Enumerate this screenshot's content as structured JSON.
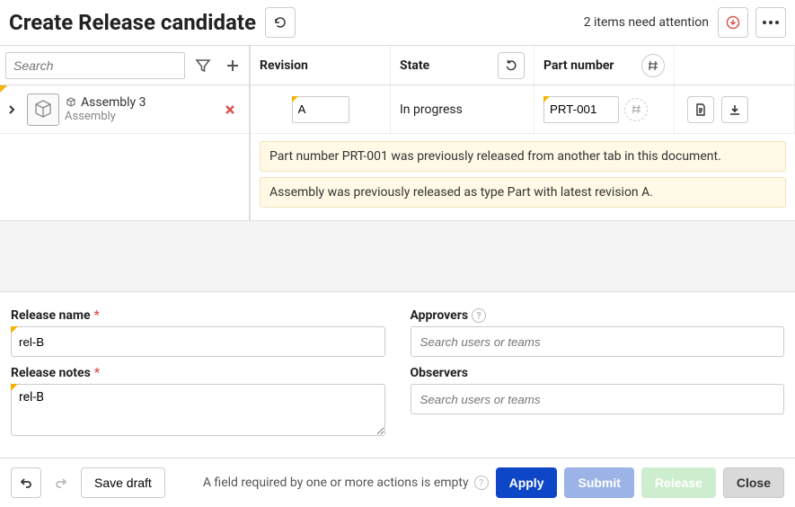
{
  "header": {
    "title": "Create Release candidate",
    "attention_text": "2 items need attention"
  },
  "search": {
    "placeholder": "Search"
  },
  "columns": {
    "revision": "Revision",
    "state": "State",
    "part_number": "Part number"
  },
  "tree": {
    "item": {
      "name": "Assembly 3",
      "kind": "Assembly"
    }
  },
  "row": {
    "revision": "A",
    "state": "In progress",
    "part_number": "PRT-001"
  },
  "warnings": [
    "Part number PRT-001 was previously released from another tab in this document.",
    "Assembly was previously released as type Part with latest revision A."
  ],
  "form": {
    "release_name_label": "Release name",
    "release_name_value": "rel-B",
    "release_notes_label": "Release notes",
    "release_notes_value": "rel-B",
    "approvers_label": "Approvers",
    "observers_label": "Observers",
    "user_search_placeholder": "Search users or teams"
  },
  "footer": {
    "message": "A field required by one or more actions is empty",
    "save_draft": "Save draft",
    "apply": "Apply",
    "submit": "Submit",
    "release": "Release",
    "close": "Close"
  }
}
